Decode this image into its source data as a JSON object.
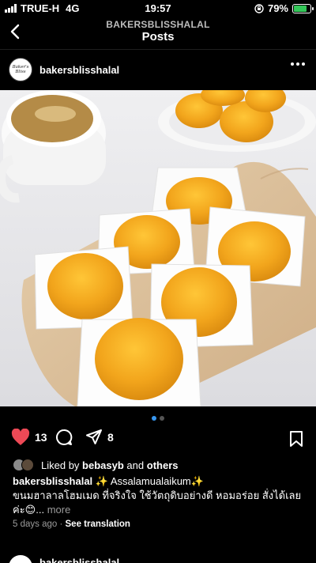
{
  "status": {
    "carrier": "TRUE-H",
    "network": "4G",
    "time": "19:57",
    "battery": "79%",
    "battery_level": 0.79
  },
  "header": {
    "account": "BAKERSBLISSHALAL",
    "title": "Posts"
  },
  "post": {
    "username": "bakersblisshalal",
    "avatar_text": "Baker's Bliss",
    "image_index": 1,
    "image_count": 2,
    "likes_count": "13",
    "shares_count": "8",
    "liked_by_prefix": "Liked by",
    "liked_by_user": "bebasyb",
    "liked_by_and": "and",
    "liked_by_others": "others",
    "caption_user": "bakersblisshalal",
    "caption_line1": "✨ Assalamualaikum✨",
    "caption_line2": "ขนมฮาลาลโฮมเมด ที่จริงใจ ใช้วัตถุดิบอย่างดี หอมอร่อย สั่งได้เลย",
    "caption_line3": "ค่ะ😊...",
    "more_label": "more",
    "timestamp": "5 days ago",
    "separator": "·",
    "see_translation": "See translation"
  },
  "next_post": {
    "username": "bakersblisshalal"
  },
  "colors": {
    "accent": "#3897f0",
    "like": "#ed4956",
    "yolk": "#f2a51c"
  }
}
